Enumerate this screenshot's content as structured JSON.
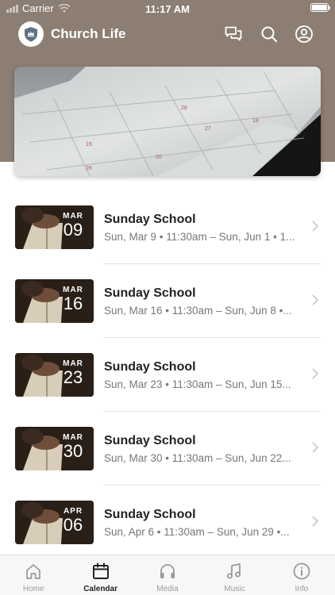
{
  "status_bar": {
    "carrier": "Carrier",
    "time": "11:17 AM"
  },
  "header": {
    "app_title": "Church Life",
    "icons": [
      "chat-icon",
      "search-icon",
      "profile-icon"
    ]
  },
  "hero": {
    "image": "calendar-photo"
  },
  "events": [
    {
      "month": "MAR",
      "day": "09",
      "title": "Sunday School",
      "subtitle": "Sun, Mar 9 • 11:30am – Sun, Jun 1 • 1..."
    },
    {
      "month": "MAR",
      "day": "16",
      "title": "Sunday School",
      "subtitle": "Sun, Mar 16 • 11:30am – Sun, Jun 8 •..."
    },
    {
      "month": "MAR",
      "day": "23",
      "title": "Sunday School",
      "subtitle": "Sun, Mar 23 • 11:30am – Sun, Jun 15..."
    },
    {
      "month": "MAR",
      "day": "30",
      "title": "Sunday School",
      "subtitle": "Sun, Mar 30 • 11:30am – Sun, Jun 22..."
    },
    {
      "month": "APR",
      "day": "06",
      "title": "Sunday School",
      "subtitle": "Sun, Apr 6 • 11:30am – Sun, Jun 29 •..."
    }
  ],
  "tabs": [
    {
      "label": "Home",
      "icon": "home-icon",
      "active": false
    },
    {
      "label": "Calendar",
      "icon": "calendar-icon",
      "active": true
    },
    {
      "label": "Media",
      "icon": "headphones-icon",
      "active": false
    },
    {
      "label": "Music",
      "icon": "music-note-icon",
      "active": false
    },
    {
      "label": "Info",
      "icon": "info-icon",
      "active": false
    }
  ],
  "colors": {
    "header_bg": "#8d7e73",
    "tab_active": "#222222",
    "tab_inactive": "#999999",
    "subtitle": "#777777"
  }
}
